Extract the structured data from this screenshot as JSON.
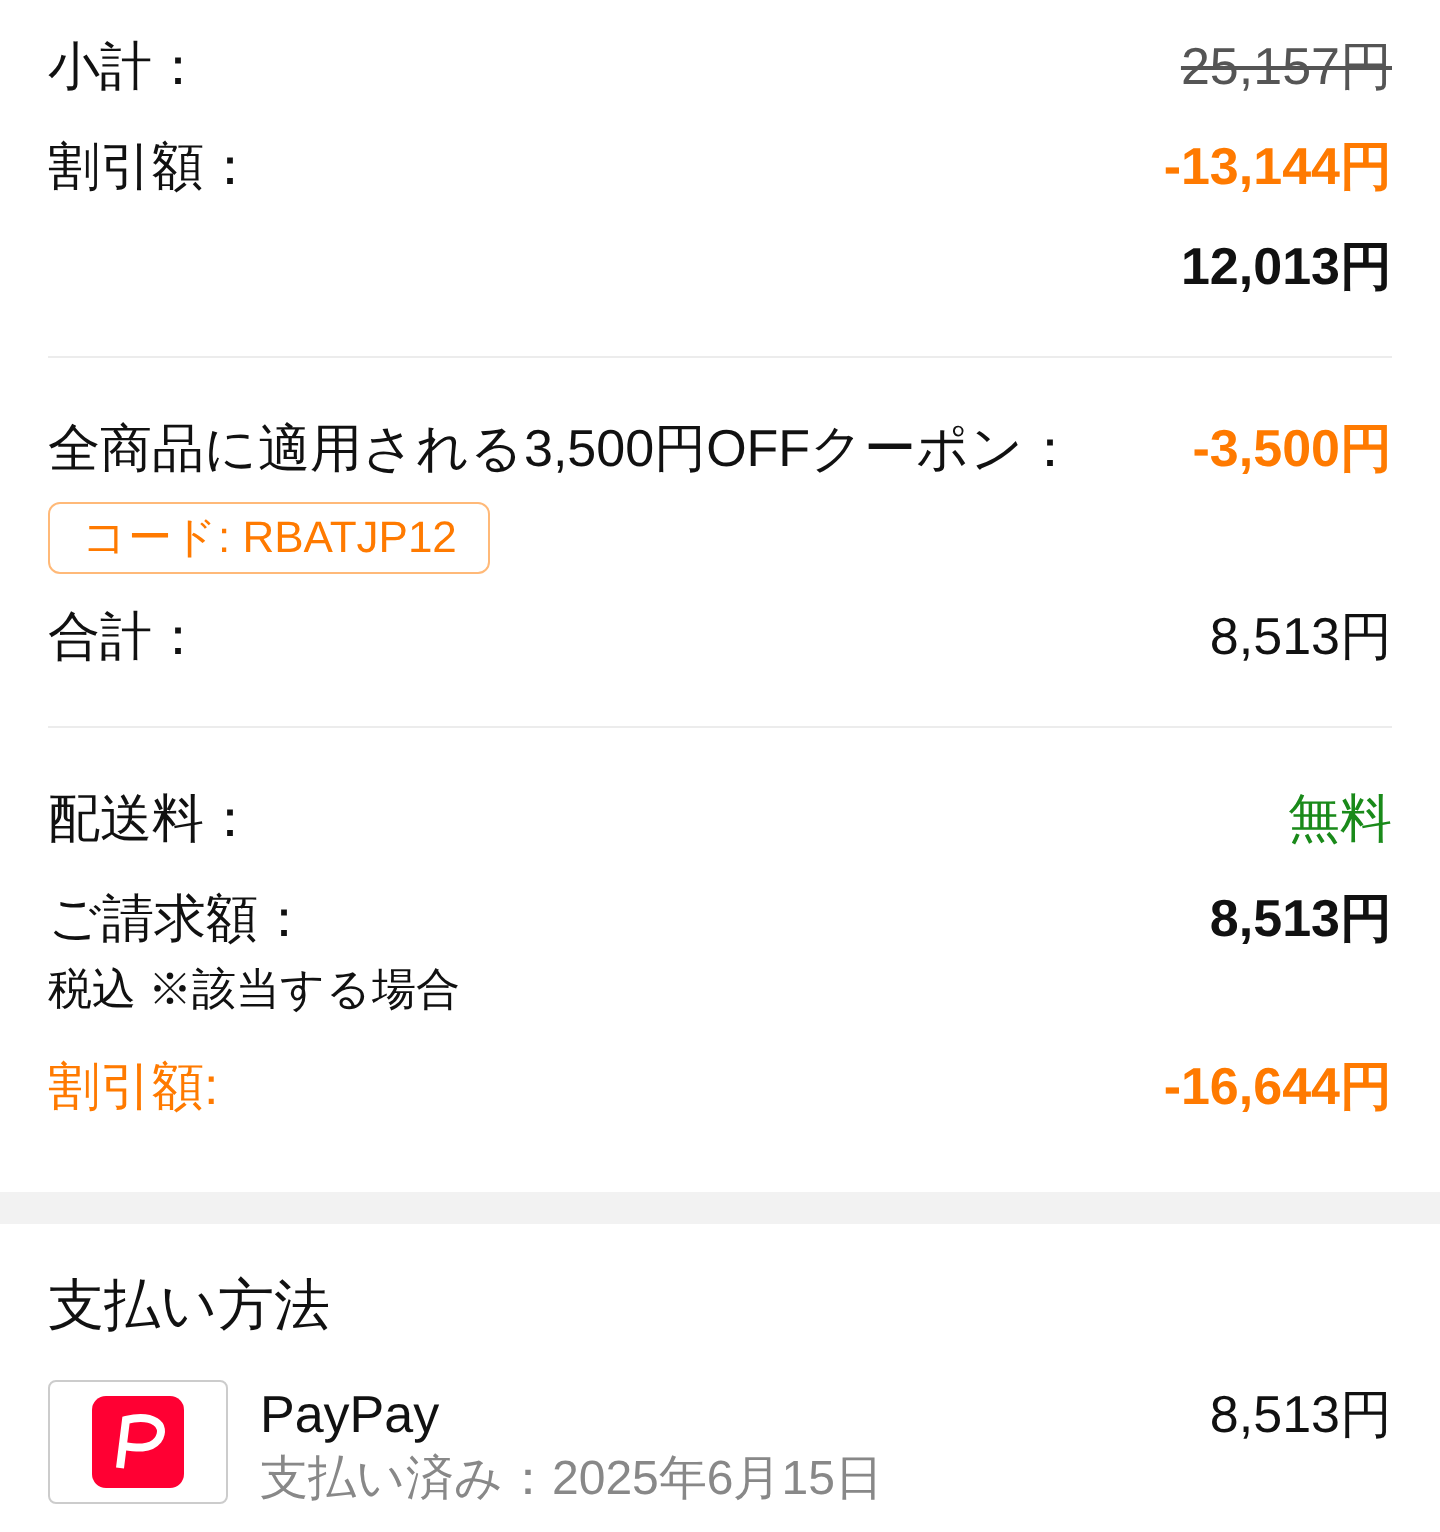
{
  "summary": {
    "groups": [
      {
        "rows": [
          {
            "label": "小計：",
            "accent_label": false,
            "amount": "25,157円",
            "kind": "strike"
          },
          {
            "label": "割引額：",
            "accent_label": false,
            "amount": "-13,144円",
            "kind": "discount"
          },
          {
            "amount": "12,013円",
            "kind": "strong"
          }
        ]
      },
      {
        "rows": [
          {
            "label": "全商品に適用される3,500円OFFクーポン：",
            "accent_label": false,
            "amount": "-3,500円",
            "kind": "discount",
            "code": "コード: RBATJP12"
          },
          {
            "label": "合計：",
            "accent_label": false,
            "amount": "8,513円",
            "kind": "plain"
          }
        ]
      },
      {
        "rows": [
          {
            "label": "配送料：",
            "accent_label": false,
            "amount": "無料",
            "kind": "free"
          },
          {
            "label": "ご請求額：",
            "accent_label": false,
            "amount": "8,513円",
            "kind": "strong",
            "note": "税込 ※該当する場合"
          },
          {
            "label": "割引額:",
            "accent_label": true,
            "amount": "-16,644円",
            "kind": "discount"
          }
        ]
      }
    ]
  },
  "payment": {
    "title": "支払い方法",
    "method": {
      "name": "PayPay",
      "status": "支払い済み：2025年6月15日",
      "amount": "8,513円"
    }
  }
}
